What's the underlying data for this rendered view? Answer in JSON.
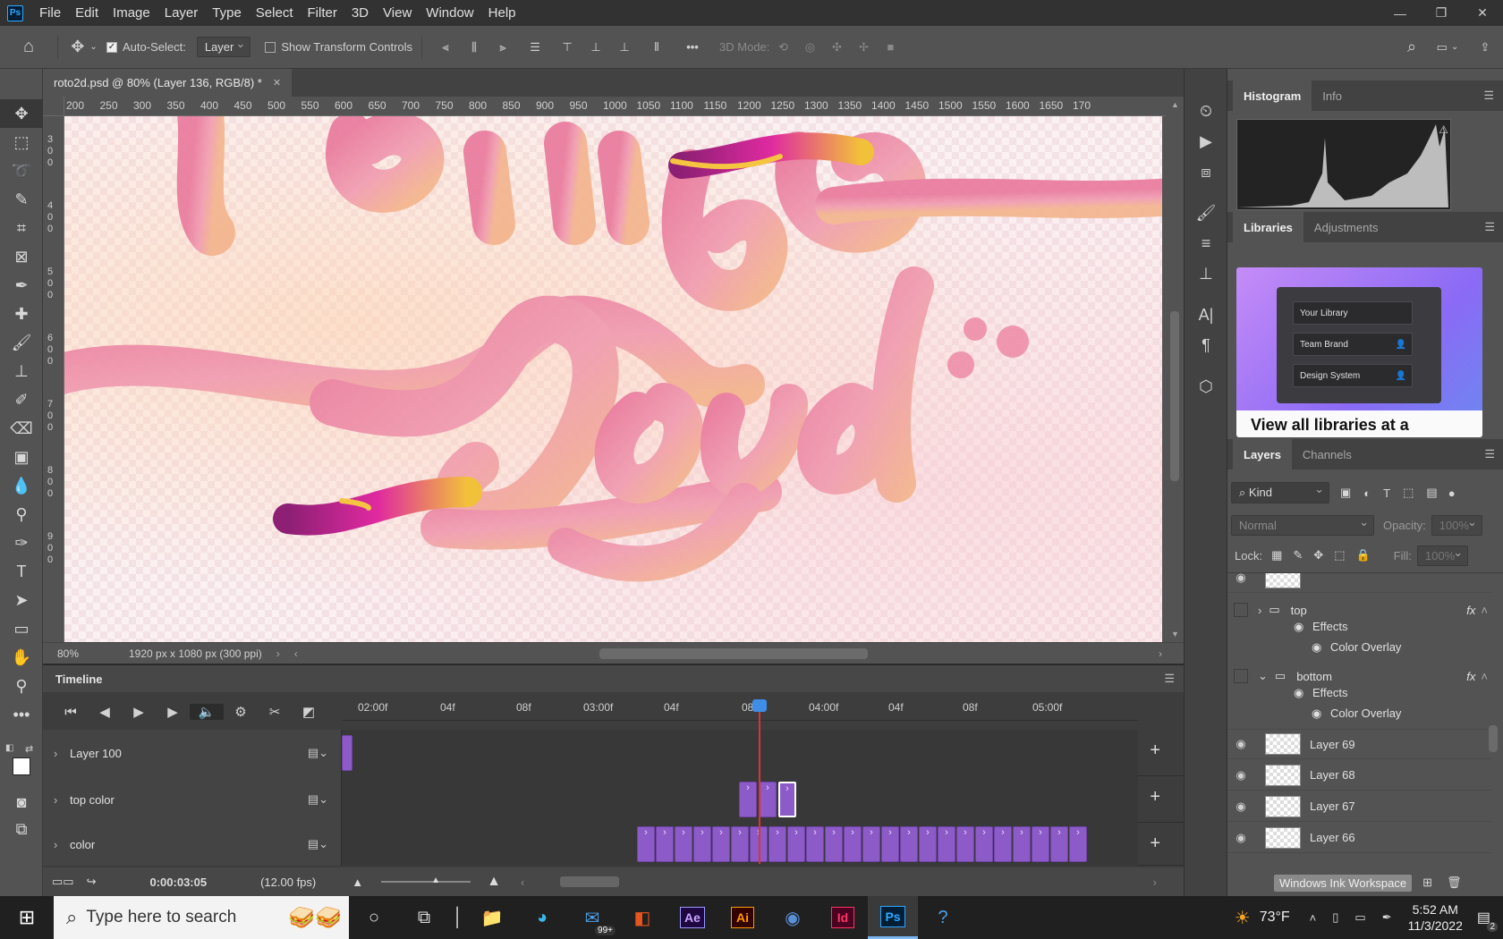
{
  "app": {
    "logo_text": "Ps",
    "menu": [
      "File",
      "Edit",
      "Image",
      "Layer",
      "Type",
      "Select",
      "Filter",
      "3D",
      "View",
      "Window",
      "Help"
    ],
    "window_controls": [
      "—",
      "❐",
      "✕"
    ]
  },
  "options_bar": {
    "auto_select_label": "Auto-Select:",
    "auto_select_checked": true,
    "auto_select_target": "Layer",
    "show_transform_label": "Show Transform Controls",
    "mode_3d_label": "3D Mode:",
    "more_label": "•••"
  },
  "document": {
    "tab_title": "roto2d.psd @ 80% (Layer 136, RGB/8) *",
    "close_glyph": "✕",
    "ruler_top": [
      "200",
      "250",
      "300",
      "350",
      "400",
      "450",
      "500",
      "550",
      "600",
      "650",
      "700",
      "750",
      "800",
      "850",
      "900",
      "950",
      "1000",
      "1050",
      "1100",
      "1150",
      "1200",
      "1250",
      "1300",
      "1350",
      "1400",
      "1450",
      "1500",
      "1550",
      "1600",
      "1650",
      "170"
    ],
    "ruler_left": [
      "3\n0\n0",
      "4\n0\n0",
      "5\n0\n0",
      "6\n0\n0",
      "7\n0\n0",
      "8\n0\n0",
      "9\n0\n0"
    ],
    "zoom": "80%",
    "dimensions": "1920 px x 1080 px (300 ppi)"
  },
  "timeline": {
    "title": "Timeline",
    "ticks": [
      "02:00f",
      "04f",
      "08f",
      "03:00f",
      "04f",
      "08f",
      "04:00f",
      "04f",
      "08f",
      "05:00f"
    ],
    "tracks": [
      {
        "name": "Layer 100"
      },
      {
        "name": "top color"
      },
      {
        "name": "color"
      }
    ],
    "current_time": "0:00:03:05",
    "fps": "(12.00 fps)"
  },
  "panels": {
    "top_tabs": [
      "Histogram",
      "Info"
    ],
    "mid_tabs": [
      "Libraries",
      "Adjustments"
    ],
    "library_items": [
      "Your Library",
      "Team Brand",
      "Design System"
    ],
    "library_caption": "View all libraries at a",
    "layer_tabs": [
      "Layers",
      "Channels"
    ],
    "kind_label": "Kind",
    "blend_mode": "Normal",
    "opacity_label": "Opacity:",
    "opacity_value": "100%",
    "lock_label": "Lock:",
    "fill_label": "Fill:",
    "fill_value": "100%",
    "groups": [
      {
        "name": "top",
        "effects": "Effects",
        "effect": "Color Overlay"
      },
      {
        "name": "bottom",
        "effects": "Effects",
        "effect": "Color Overlay"
      }
    ],
    "fx_label": "fx",
    "layers": [
      "Layer 69",
      "Layer 68",
      "Layer 67",
      "Layer 66"
    ],
    "watermark": "Windows Ink Workspace"
  },
  "taskbar": {
    "search_placeholder": "Type here to search",
    "mail_badge": "99+",
    "temperature": "73°F",
    "time": "5:52 AM",
    "date": "11/3/2022",
    "notification_count": "2"
  }
}
